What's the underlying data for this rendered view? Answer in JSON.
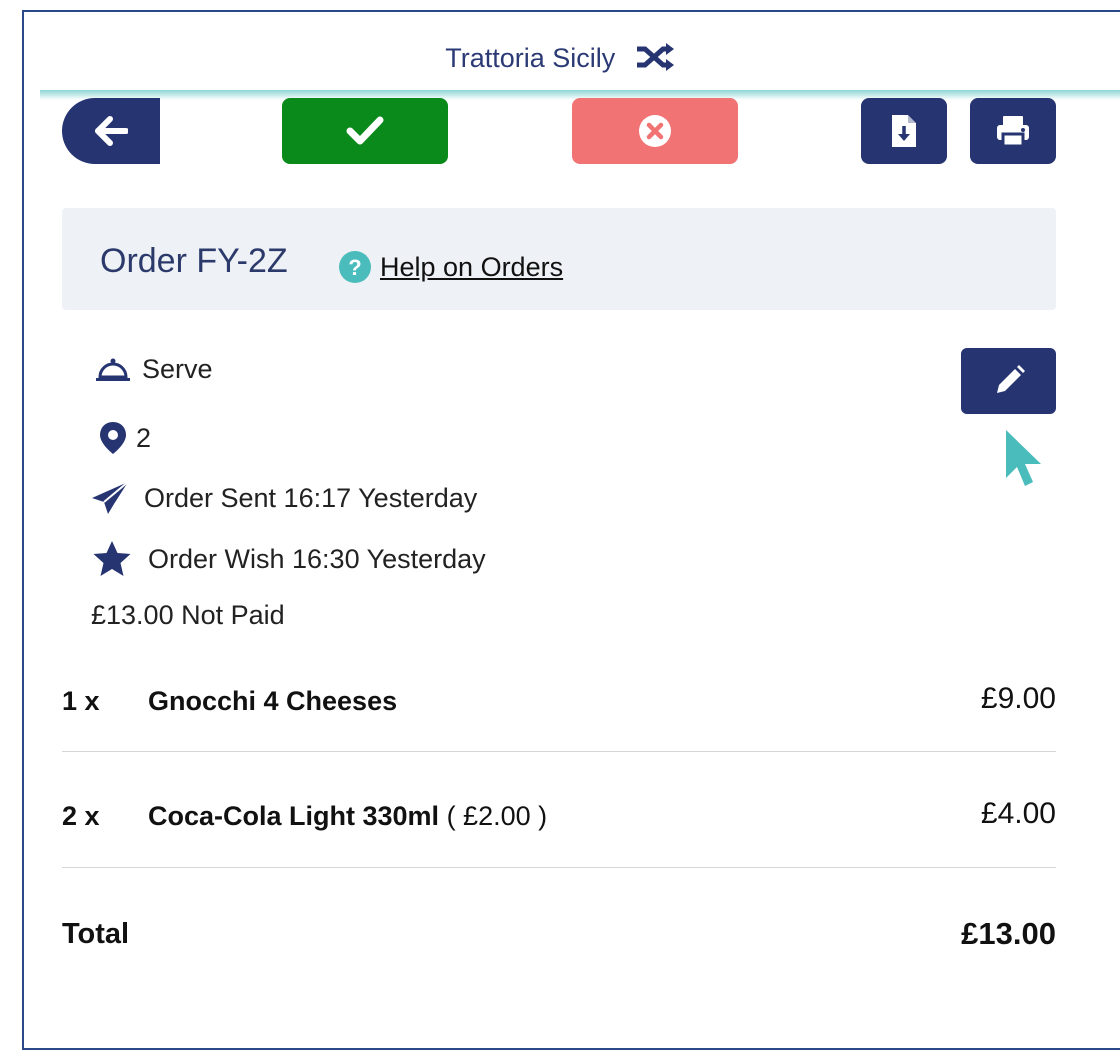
{
  "header": {
    "title": "Trattoria Sicily"
  },
  "order": {
    "title": "Order FY-2Z",
    "help_link": "Help on Orders"
  },
  "info": {
    "service": "Serve",
    "table": "2",
    "sent": "Order Sent 16:17 Yesterday",
    "wish": "Order Wish 16:30 Yesterday",
    "payment": "£13.00 Not Paid"
  },
  "items": [
    {
      "qty": "1 x",
      "name": "Gnocchi 4 Cheeses",
      "unit": "",
      "price": "£9.00"
    },
    {
      "qty": "2 x",
      "name": "Coca-Cola Light 330ml",
      "unit": " ( £2.00 )",
      "price": "£4.00"
    }
  ],
  "total": {
    "label": "Total",
    "value": "£13.00"
  },
  "colors": {
    "navy": "#263571",
    "green": "#0a8a1a",
    "red": "#f27373",
    "teal": "#4bbcbc"
  },
  "icons": [
    "shuffle-icon",
    "arrow-left-icon",
    "check-icon",
    "times-circle-icon",
    "file-download-icon",
    "print-icon",
    "question-circle-icon",
    "pencil-icon",
    "cloche-icon",
    "map-pin-icon",
    "paper-plane-icon",
    "star-icon",
    "cursor-icon"
  ]
}
